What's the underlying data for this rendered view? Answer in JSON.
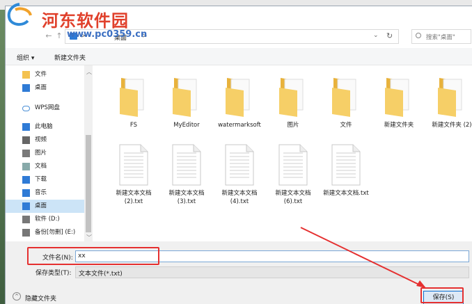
{
  "window": {
    "bg_strip_text": ""
  },
  "watermark": {
    "title": "河东软件园",
    "url": "www.pc0359.cn"
  },
  "address": {
    "segment": "桌面",
    "sep": ">"
  },
  "search": {
    "placeholder": "搜索\"桌面\""
  },
  "toolbar": {
    "organize": "组织 ▾",
    "new_folder": "新建文件夹"
  },
  "sidebar": {
    "items": [
      {
        "label": "文件",
        "icon": "folder-icon"
      },
      {
        "label": "桌面",
        "icon": "desktop-icon"
      },
      {
        "label": "WPS网盘",
        "icon": "cloud-icon"
      },
      {
        "label": "此电脑",
        "icon": "computer-icon"
      },
      {
        "label": "视频",
        "icon": "video-icon"
      },
      {
        "label": "图片",
        "icon": "picture-icon"
      },
      {
        "label": "文档",
        "icon": "document-icon"
      },
      {
        "label": "下载",
        "icon": "download-icon"
      },
      {
        "label": "音乐",
        "icon": "music-icon"
      },
      {
        "label": "桌面",
        "icon": "desktop-icon"
      },
      {
        "label": "软件 (D:)",
        "icon": "drive-icon"
      },
      {
        "label": "备份[勿删] (E:)",
        "icon": "drive-icon"
      }
    ]
  },
  "files": [
    {
      "label": "FS",
      "type": "folder"
    },
    {
      "label": "MyEditor",
      "type": "folder"
    },
    {
      "label": "watermarksoft",
      "type": "folder"
    },
    {
      "label": "图片",
      "type": "folder"
    },
    {
      "label": "文件",
      "type": "folder"
    },
    {
      "label": "新建文件夹",
      "type": "folder"
    },
    {
      "label": "新建文件夹 (2)",
      "type": "folder"
    },
    {
      "label": "新建文本文档 (2).txt",
      "type": "txt"
    },
    {
      "label": "新建文本文档 (3).txt",
      "type": "txt"
    },
    {
      "label": "新建文本文档 (4).txt",
      "type": "txt"
    },
    {
      "label": "新建文本文档 (6).txt",
      "type": "txt"
    },
    {
      "label": "新建文本文档.txt",
      "type": "txt"
    }
  ],
  "bottom": {
    "filename_label": "文件名(N):",
    "filename_value": "xx",
    "filetype_label": "保存类型(T):",
    "filetype_value": "文本文件(*.txt)",
    "hide_folders": "隐藏文件夹",
    "save": "保存(S)"
  },
  "colors": {
    "accent": "#0b6fd0",
    "highlight": "#e53030",
    "folder": "#f4c24f"
  }
}
